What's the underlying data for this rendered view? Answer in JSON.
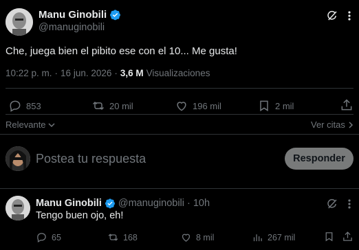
{
  "tweet": {
    "author_name": "Manu Ginobili",
    "author_handle": "@manuginobili",
    "text": "Che, juega bien el pibito ese con el 10... Me gusta!",
    "time": "10:22 p. m.",
    "sep": "·",
    "date": "16 jun. 2026",
    "dot": "·",
    "views_count": "3,6 M",
    "views_label": "Visualizaciones",
    "stats": {
      "replies": "853",
      "retweets": "20 mil",
      "likes": "196 mil",
      "bookmarks": "2 mil"
    }
  },
  "sort": {
    "relevant_label": "Relevante",
    "quotes_label": "Ver citas"
  },
  "composer": {
    "placeholder": "Postea tu respuesta",
    "reply_button": "Responder"
  },
  "reply": {
    "author_name": "Manu Ginobili",
    "author_handle": "@manuginobili",
    "sep": "·",
    "age": "10h",
    "text": "Tengo buen ojo, eh!",
    "stats": {
      "replies": "65",
      "retweets": "168",
      "likes": "8 mil",
      "views": "267 mil"
    }
  },
  "colors": {
    "background": "#000000",
    "verified": "#1d9bf0",
    "muted": "#71767b",
    "divider": "#2f3336"
  },
  "icons": [
    "verified-badge-icon",
    "grok-icon",
    "more-icon",
    "reply-icon",
    "retweet-icon",
    "like-icon",
    "bookmark-icon",
    "share-icon",
    "chevron-down-icon",
    "views-icon"
  ]
}
